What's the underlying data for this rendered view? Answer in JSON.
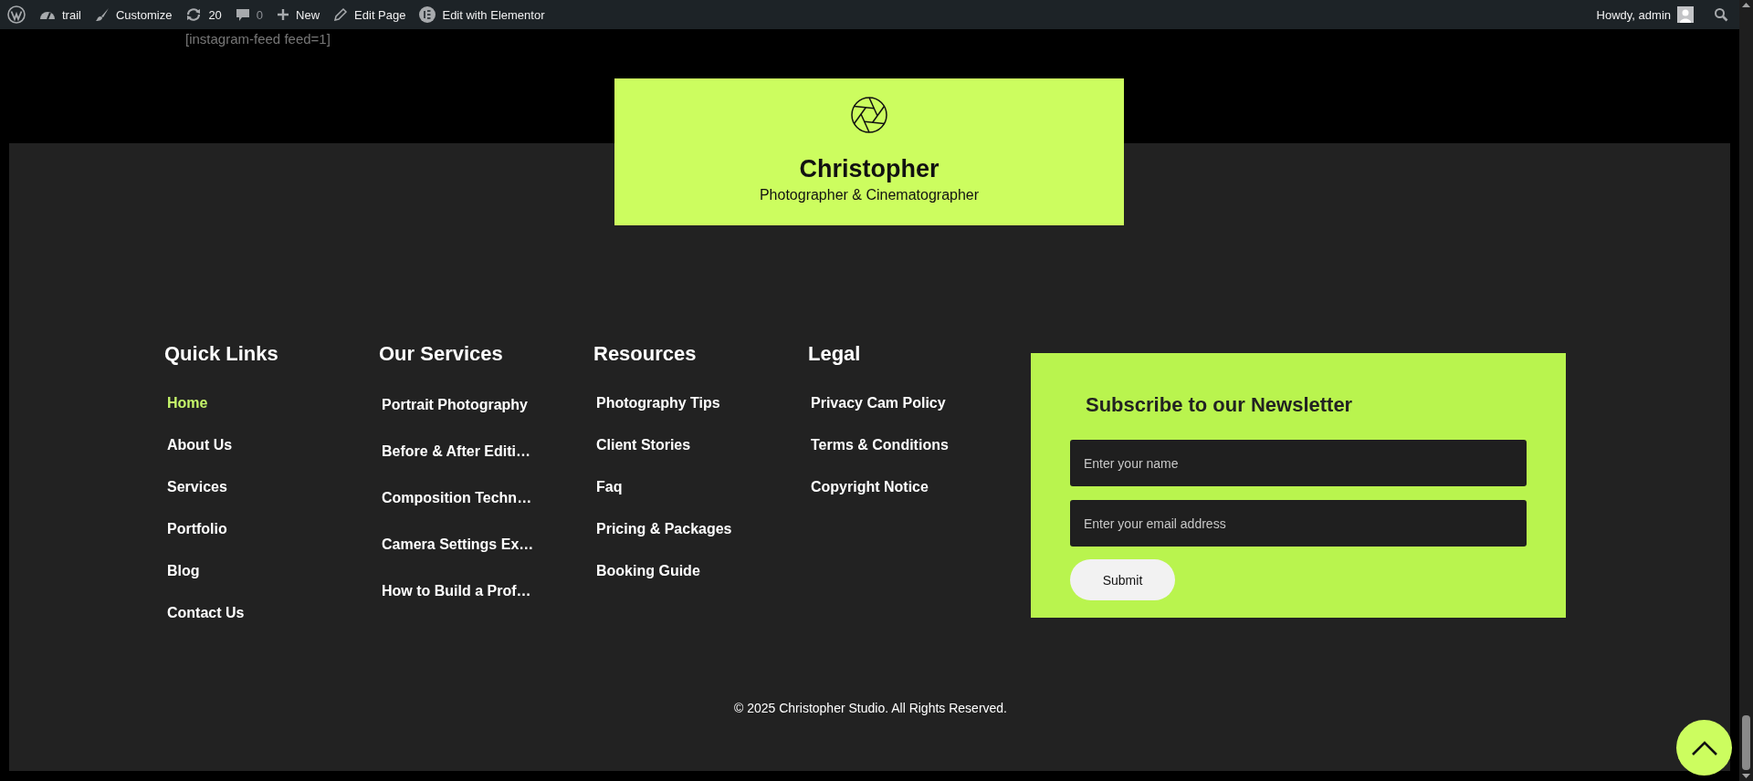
{
  "admin_bar": {
    "items": [
      {
        "kind": "wp-logo"
      },
      {
        "kind": "dashboard",
        "label": "trail"
      },
      {
        "kind": "brush",
        "label": "Customize"
      },
      {
        "kind": "updates",
        "label": "20"
      },
      {
        "kind": "comments",
        "label": "0"
      },
      {
        "kind": "plus",
        "label": "New"
      },
      {
        "kind": "pencil",
        "label": "Edit Page"
      },
      {
        "kind": "elementor",
        "label": "Edit with Elementor"
      }
    ],
    "greeting": "Howdy, admin"
  },
  "shortcode_text": "[instagram-feed feed=1]",
  "brand": {
    "name": "Christopher",
    "tagline": "Photographer & Cinematographer"
  },
  "columns": [
    {
      "heading": "Quick Links",
      "links": [
        {
          "label": "Home",
          "selected": true
        },
        {
          "label": "About Us",
          "selected": false
        },
        {
          "label": "Services",
          "selected": false
        },
        {
          "label": "Portfolio",
          "selected": false
        },
        {
          "label": "Blog",
          "selected": false
        },
        {
          "label": "Contact Us",
          "selected": false
        }
      ]
    },
    {
      "heading": "Our Services",
      "links": [
        {
          "label": "Portrait Photography",
          "selected": false
        },
        {
          "label": "Before & After Editi…",
          "selected": false
        },
        {
          "label": "Composition Techn…",
          "selected": false
        },
        {
          "label": "Camera Settings Ex…",
          "selected": false
        },
        {
          "label": "How to Build a Prof…",
          "selected": false
        }
      ]
    },
    {
      "heading": "Resources",
      "links": [
        {
          "label": "Photography Tips",
          "selected": false
        },
        {
          "label": "Client Stories",
          "selected": false
        },
        {
          "label": "Faq",
          "selected": false
        },
        {
          "label": "Pricing & Packages",
          "selected": false
        },
        {
          "label": "Booking Guide",
          "selected": false
        }
      ]
    },
    {
      "heading": "Legal",
      "links": [
        {
          "label": "Privacy Cam Policy",
          "selected": false
        },
        {
          "label": "Terms & Conditions",
          "selected": false
        },
        {
          "label": "Copyright Notice",
          "selected": false
        }
      ]
    }
  ],
  "newsletter": {
    "title": "Subscribe to our Newsletter",
    "fields": [
      {
        "placeholder": "Enter your name"
      },
      {
        "placeholder": "Enter your email address"
      }
    ],
    "button": "Submit"
  },
  "copyright": "© 2025 Christopher Studio. All Rights Reserved."
}
